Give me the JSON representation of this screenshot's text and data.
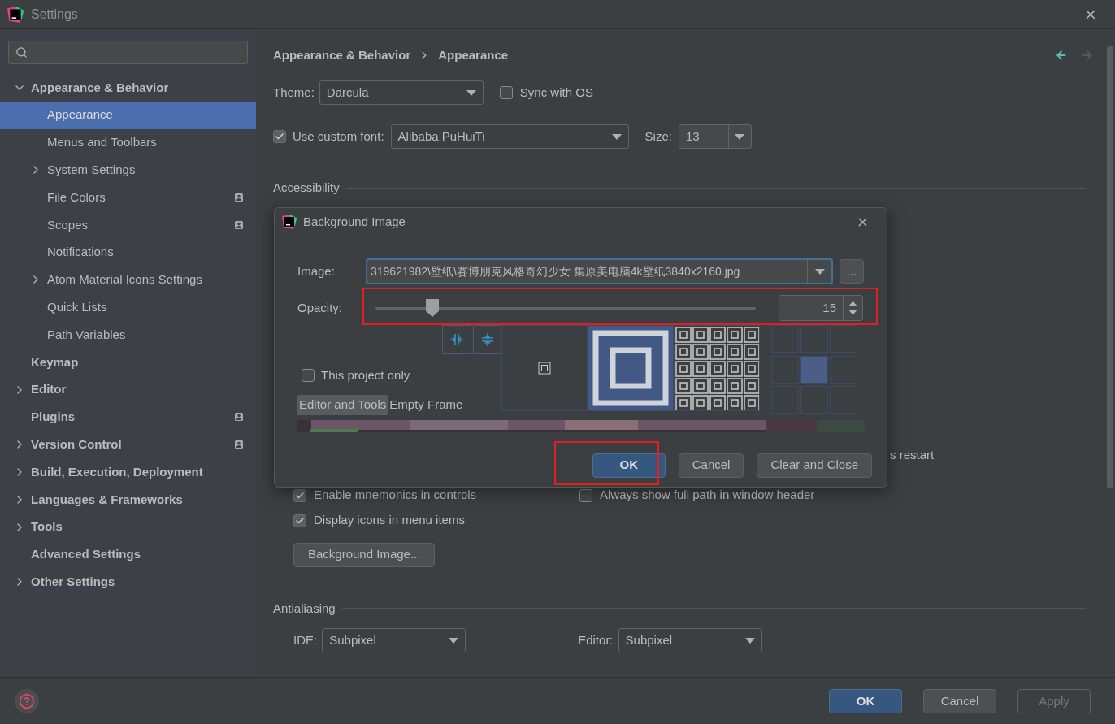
{
  "window": {
    "title": "Settings"
  },
  "sidebar": {
    "items": [
      {
        "label": "Appearance & Behavior",
        "expandable": true,
        "expanded": true,
        "selected": false,
        "shared": false,
        "children": [
          {
            "label": "Appearance",
            "expandable": false,
            "expanded": false,
            "selected": true,
            "shared": false
          },
          {
            "label": "Menus and Toolbars",
            "expandable": false,
            "expanded": false,
            "selected": false,
            "shared": false
          },
          {
            "label": "System Settings",
            "expandable": true,
            "expanded": false,
            "selected": false,
            "shared": false
          },
          {
            "label": "File Colors",
            "expandable": false,
            "expanded": false,
            "selected": false,
            "shared": true
          },
          {
            "label": "Scopes",
            "expandable": false,
            "expanded": false,
            "selected": false,
            "shared": true
          },
          {
            "label": "Notifications",
            "expandable": false,
            "expanded": false,
            "selected": false,
            "shared": false
          },
          {
            "label": "Atom Material Icons Settings",
            "expandable": true,
            "expanded": false,
            "selected": false,
            "shared": false
          },
          {
            "label": "Quick Lists",
            "expandable": false,
            "expanded": false,
            "selected": false,
            "shared": false
          },
          {
            "label": "Path Variables",
            "expandable": false,
            "expanded": false,
            "selected": false,
            "shared": false
          }
        ]
      },
      {
        "label": "Keymap",
        "expandable": false,
        "expanded": false,
        "selected": false,
        "shared": false
      },
      {
        "label": "Editor",
        "expandable": true,
        "expanded": false,
        "selected": false,
        "shared": false
      },
      {
        "label": "Plugins",
        "expandable": false,
        "expanded": false,
        "selected": false,
        "shared": true
      },
      {
        "label": "Version Control",
        "expandable": true,
        "expanded": false,
        "selected": false,
        "shared": true
      },
      {
        "label": "Build, Execution, Deployment",
        "expandable": true,
        "expanded": false,
        "selected": false,
        "shared": false
      },
      {
        "label": "Languages & Frameworks",
        "expandable": true,
        "expanded": false,
        "selected": false,
        "shared": false
      },
      {
        "label": "Tools",
        "expandable": true,
        "expanded": false,
        "selected": false,
        "shared": false
      },
      {
        "label": "Advanced Settings",
        "expandable": false,
        "expanded": false,
        "selected": false,
        "shared": false
      },
      {
        "label": "Other Settings",
        "expandable": true,
        "expanded": false,
        "selected": false,
        "shared": false
      }
    ]
  },
  "breadcrumb": [
    "Appearance & Behavior",
    "Appearance"
  ],
  "theme": {
    "label": "Theme:",
    "value": "Darcula"
  },
  "sync_with_os": {
    "label": "Sync with OS",
    "checked": false
  },
  "custom_font": {
    "label": "Use custom font:",
    "checked": true,
    "value": "Alibaba PuHuiTi"
  },
  "size": {
    "label": "Size:",
    "value": "13"
  },
  "accessibility": {
    "title": "Accessibility"
  },
  "restart_note": "s restart",
  "partial_rows": [
    {
      "label": "Enable mnemonics in controls",
      "checked": true
    },
    {
      "label": "Always show full path in window header",
      "checked": false
    }
  ],
  "display_icons": {
    "label": "Display icons in menu items",
    "checked": true
  },
  "background_image_button": "Background Image...",
  "antialiasing": {
    "title": "Antialiasing",
    "ide": {
      "label": "IDE:",
      "value": "Subpixel"
    },
    "editor": {
      "label": "Editor:",
      "value": "Subpixel"
    }
  },
  "footer_buttons": [
    {
      "label": "OK",
      "kind": "primary",
      "disabled": false
    },
    {
      "label": "Cancel",
      "kind": "normal",
      "disabled": false
    },
    {
      "label": "Apply",
      "kind": "normal",
      "disabled": true
    }
  ],
  "dialog": {
    "title": "Background Image",
    "image": {
      "label": "Image:",
      "value": "319621982\\壁纸\\赛博朋克风格奇幻少女 集原美电脑4k壁纸3840x2160.jpg"
    },
    "browse": "...",
    "opacity": {
      "label": "Opacity:",
      "level": 0.15,
      "reading": "15"
    },
    "this_project_only": {
      "label": "This project only",
      "checked": false
    },
    "tabs": [
      {
        "label": "Editor and Tools",
        "selected": true
      },
      {
        "label": "Empty Frame",
        "selected": false
      }
    ],
    "fill_modes": [
      {
        "kind": "plain",
        "selected": false
      },
      {
        "kind": "scale",
        "selected": true
      },
      {
        "kind": "tile",
        "selected": false
      }
    ],
    "anchors": [
      {
        "selected": false
      },
      {
        "selected": false
      },
      {
        "selected": false
      },
      {
        "selected": false
      },
      {
        "selected": true
      },
      {
        "selected": false
      },
      {
        "selected": false
      },
      {
        "selected": false
      },
      {
        "selected": false
      }
    ],
    "buttons": [
      {
        "label": "OK",
        "kind": "primary"
      },
      {
        "label": "Cancel",
        "kind": "normal"
      },
      {
        "label": "Clear and Close",
        "kind": "normal"
      }
    ]
  }
}
